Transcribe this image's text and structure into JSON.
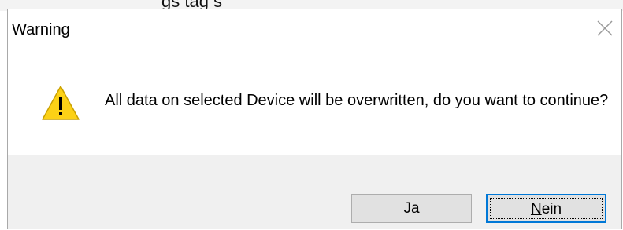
{
  "background": {
    "partial_text": "gs tag s"
  },
  "dialog": {
    "title": "Warning",
    "message": "All data on selected Device will be overwritten, do you want to continue?",
    "icon": "warning-icon",
    "close_icon": "close-icon",
    "buttons": {
      "yes": {
        "accelerator": "J",
        "rest": "a"
      },
      "no": {
        "accelerator": "N",
        "rest": "ein"
      }
    }
  },
  "colors": {
    "accent": "#0078d7",
    "warning_fill": "#fcd116",
    "button_face": "#e1e1e1",
    "button_area": "#f0f0f0"
  }
}
